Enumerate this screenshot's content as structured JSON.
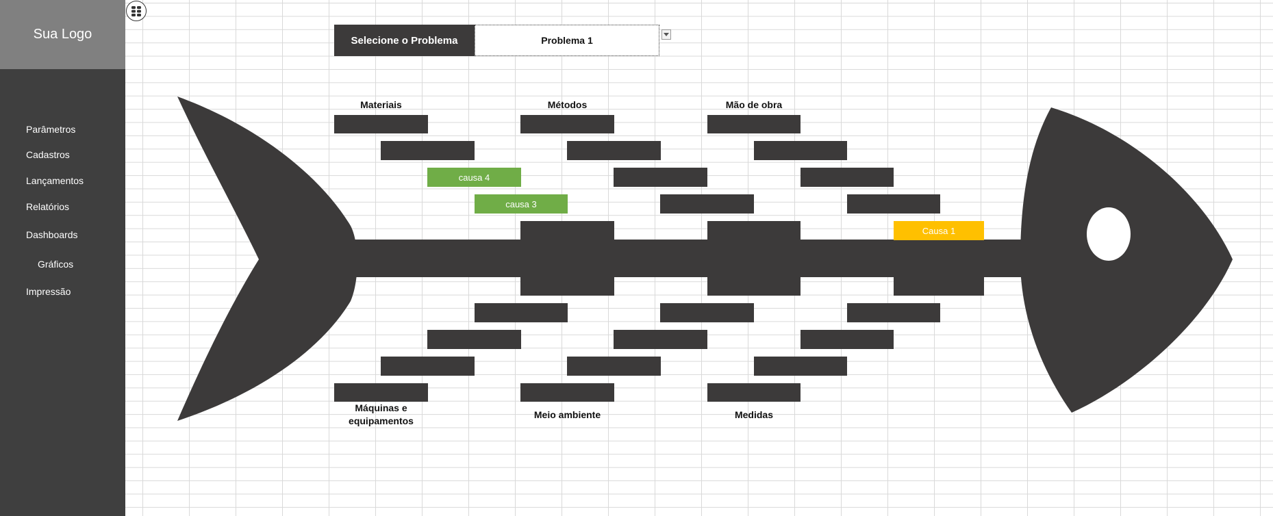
{
  "sidebar": {
    "logo": "Sua Logo",
    "items": [
      {
        "label": "Parâmetros"
      },
      {
        "label": "Cadastros"
      },
      {
        "label": "Lançamentos"
      },
      {
        "label": "Relatórios"
      },
      {
        "label": "Dashboards"
      },
      {
        "label": "Gráficos"
      },
      {
        "label": "Impressão"
      }
    ]
  },
  "toolbar": {
    "menu_icon": "menu-grid-icon"
  },
  "problem_selector": {
    "label": "Selecione o Problema",
    "value": "Problema 1"
  },
  "diagram": {
    "categories": {
      "materiais": "Materiais",
      "metodos": "Métodos",
      "mao_de_obra": "Mão de obra",
      "maquinas_1": "Máquinas e",
      "maquinas_2": "equipamentos",
      "meio_ambiente": "Meio ambiente",
      "medidas": "Medidas"
    },
    "causes": {
      "causa4": "causa 4",
      "causa3": "causa 3",
      "causa1": "Causa 1"
    },
    "colors": {
      "fish": "#3c3a3a",
      "green": "#70ad47",
      "yellow": "#ffc000"
    }
  }
}
